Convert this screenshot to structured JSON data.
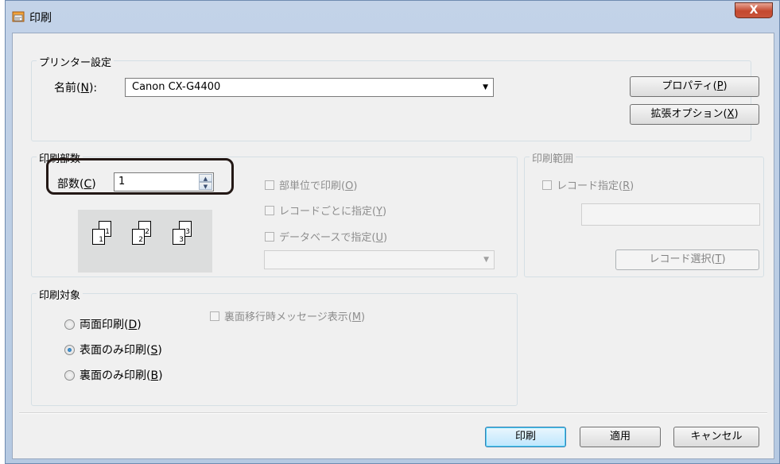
{
  "window": {
    "title": "印刷",
    "close_label": "X"
  },
  "printer_settings": {
    "group_label": "プリンター設定",
    "name_label_pre": "名前(",
    "name_label_key": "N",
    "name_label_post": "):",
    "printer_name": "Canon CX-G4400",
    "properties_pre": "プロパティ(",
    "properties_key": "P",
    "properties_post": ")",
    "ext_options_pre": "拡張オプション(",
    "ext_options_key": "X",
    "ext_options_post": ")"
  },
  "copies": {
    "group_label": "印刷部数",
    "label_pre": "部数(",
    "label_key": "C",
    "label_post": ")",
    "value": "1",
    "collate_pre": "部単位で印刷(",
    "collate_key": "O",
    "collate_post": ")",
    "per_record_pre": "レコードごとに指定(",
    "per_record_key": "Y",
    "per_record_post": ")",
    "by_database_pre": "データベースで指定(",
    "by_database_key": "U",
    "by_database_post": ")",
    "pages": [
      "1",
      "2",
      "3"
    ]
  },
  "range": {
    "group_label": "印刷範囲",
    "record_spec_pre": "レコード指定(",
    "record_spec_key": "R",
    "record_spec_post": ")",
    "select_pre": "レコード選択(",
    "select_key": "T",
    "select_post": ")"
  },
  "target": {
    "group_label": "印刷対象",
    "duplex_pre": "両面印刷(",
    "duplex_key": "D",
    "duplex_post": ")",
    "front_pre": "表面のみ印刷(",
    "front_key": "S",
    "front_post": ")",
    "back_pre": "裏面のみ印刷(",
    "back_key": "B",
    "back_post": ")",
    "back_msg_pre": "裏面移行時メッセージ表示(",
    "back_msg_key": "M",
    "back_msg_post": ")",
    "selected": "front"
  },
  "footer": {
    "print_label": "印刷",
    "apply_label": "適用",
    "cancel_label": "キャンセル"
  },
  "colors": {
    "highlight_border": "#231815",
    "accent": "#3c7fb1"
  }
}
